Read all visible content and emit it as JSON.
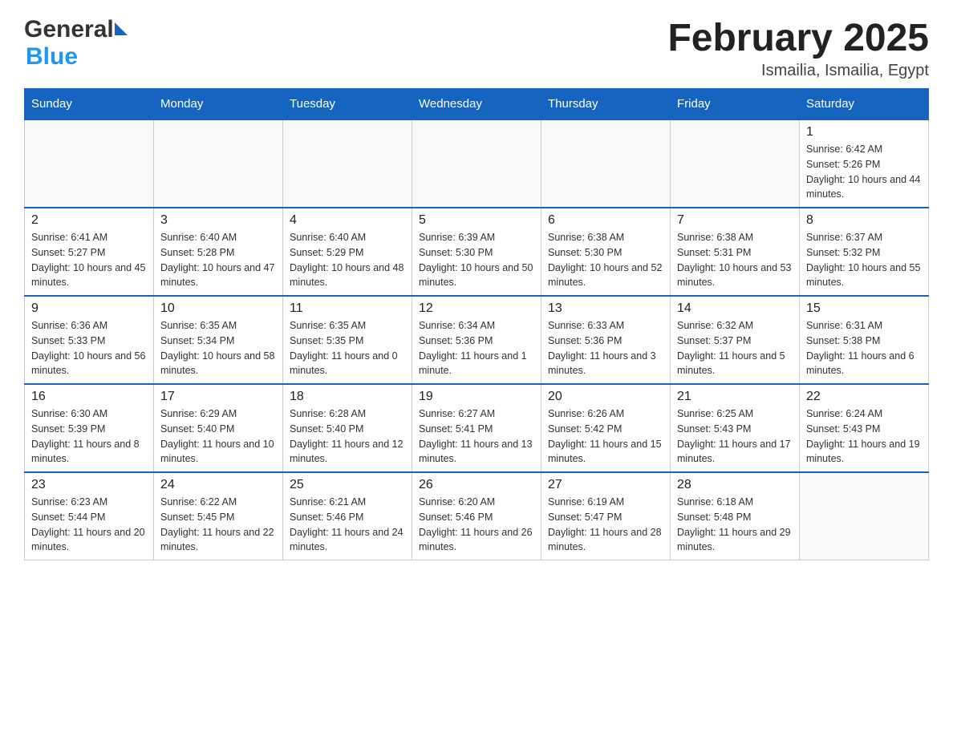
{
  "header": {
    "logo_general": "General",
    "logo_blue": "Blue",
    "month_title": "February 2025",
    "location": "Ismailia, Ismailia, Egypt"
  },
  "days_of_week": [
    "Sunday",
    "Monday",
    "Tuesday",
    "Wednesday",
    "Thursday",
    "Friday",
    "Saturday"
  ],
  "weeks": [
    {
      "days": [
        {
          "number": "",
          "info": ""
        },
        {
          "number": "",
          "info": ""
        },
        {
          "number": "",
          "info": ""
        },
        {
          "number": "",
          "info": ""
        },
        {
          "number": "",
          "info": ""
        },
        {
          "number": "",
          "info": ""
        },
        {
          "number": "1",
          "info": "Sunrise: 6:42 AM\nSunset: 5:26 PM\nDaylight: 10 hours and 44 minutes."
        }
      ]
    },
    {
      "days": [
        {
          "number": "2",
          "info": "Sunrise: 6:41 AM\nSunset: 5:27 PM\nDaylight: 10 hours and 45 minutes."
        },
        {
          "number": "3",
          "info": "Sunrise: 6:40 AM\nSunset: 5:28 PM\nDaylight: 10 hours and 47 minutes."
        },
        {
          "number": "4",
          "info": "Sunrise: 6:40 AM\nSunset: 5:29 PM\nDaylight: 10 hours and 48 minutes."
        },
        {
          "number": "5",
          "info": "Sunrise: 6:39 AM\nSunset: 5:30 PM\nDaylight: 10 hours and 50 minutes."
        },
        {
          "number": "6",
          "info": "Sunrise: 6:38 AM\nSunset: 5:30 PM\nDaylight: 10 hours and 52 minutes."
        },
        {
          "number": "7",
          "info": "Sunrise: 6:38 AM\nSunset: 5:31 PM\nDaylight: 10 hours and 53 minutes."
        },
        {
          "number": "8",
          "info": "Sunrise: 6:37 AM\nSunset: 5:32 PM\nDaylight: 10 hours and 55 minutes."
        }
      ]
    },
    {
      "days": [
        {
          "number": "9",
          "info": "Sunrise: 6:36 AM\nSunset: 5:33 PM\nDaylight: 10 hours and 56 minutes."
        },
        {
          "number": "10",
          "info": "Sunrise: 6:35 AM\nSunset: 5:34 PM\nDaylight: 10 hours and 58 minutes."
        },
        {
          "number": "11",
          "info": "Sunrise: 6:35 AM\nSunset: 5:35 PM\nDaylight: 11 hours and 0 minutes."
        },
        {
          "number": "12",
          "info": "Sunrise: 6:34 AM\nSunset: 5:36 PM\nDaylight: 11 hours and 1 minute."
        },
        {
          "number": "13",
          "info": "Sunrise: 6:33 AM\nSunset: 5:36 PM\nDaylight: 11 hours and 3 minutes."
        },
        {
          "number": "14",
          "info": "Sunrise: 6:32 AM\nSunset: 5:37 PM\nDaylight: 11 hours and 5 minutes."
        },
        {
          "number": "15",
          "info": "Sunrise: 6:31 AM\nSunset: 5:38 PM\nDaylight: 11 hours and 6 minutes."
        }
      ]
    },
    {
      "days": [
        {
          "number": "16",
          "info": "Sunrise: 6:30 AM\nSunset: 5:39 PM\nDaylight: 11 hours and 8 minutes."
        },
        {
          "number": "17",
          "info": "Sunrise: 6:29 AM\nSunset: 5:40 PM\nDaylight: 11 hours and 10 minutes."
        },
        {
          "number": "18",
          "info": "Sunrise: 6:28 AM\nSunset: 5:40 PM\nDaylight: 11 hours and 12 minutes."
        },
        {
          "number": "19",
          "info": "Sunrise: 6:27 AM\nSunset: 5:41 PM\nDaylight: 11 hours and 13 minutes."
        },
        {
          "number": "20",
          "info": "Sunrise: 6:26 AM\nSunset: 5:42 PM\nDaylight: 11 hours and 15 minutes."
        },
        {
          "number": "21",
          "info": "Sunrise: 6:25 AM\nSunset: 5:43 PM\nDaylight: 11 hours and 17 minutes."
        },
        {
          "number": "22",
          "info": "Sunrise: 6:24 AM\nSunset: 5:43 PM\nDaylight: 11 hours and 19 minutes."
        }
      ]
    },
    {
      "days": [
        {
          "number": "23",
          "info": "Sunrise: 6:23 AM\nSunset: 5:44 PM\nDaylight: 11 hours and 20 minutes."
        },
        {
          "number": "24",
          "info": "Sunrise: 6:22 AM\nSunset: 5:45 PM\nDaylight: 11 hours and 22 minutes."
        },
        {
          "number": "25",
          "info": "Sunrise: 6:21 AM\nSunset: 5:46 PM\nDaylight: 11 hours and 24 minutes."
        },
        {
          "number": "26",
          "info": "Sunrise: 6:20 AM\nSunset: 5:46 PM\nDaylight: 11 hours and 26 minutes."
        },
        {
          "number": "27",
          "info": "Sunrise: 6:19 AM\nSunset: 5:47 PM\nDaylight: 11 hours and 28 minutes."
        },
        {
          "number": "28",
          "info": "Sunrise: 6:18 AM\nSunset: 5:48 PM\nDaylight: 11 hours and 29 minutes."
        },
        {
          "number": "",
          "info": ""
        }
      ]
    }
  ]
}
